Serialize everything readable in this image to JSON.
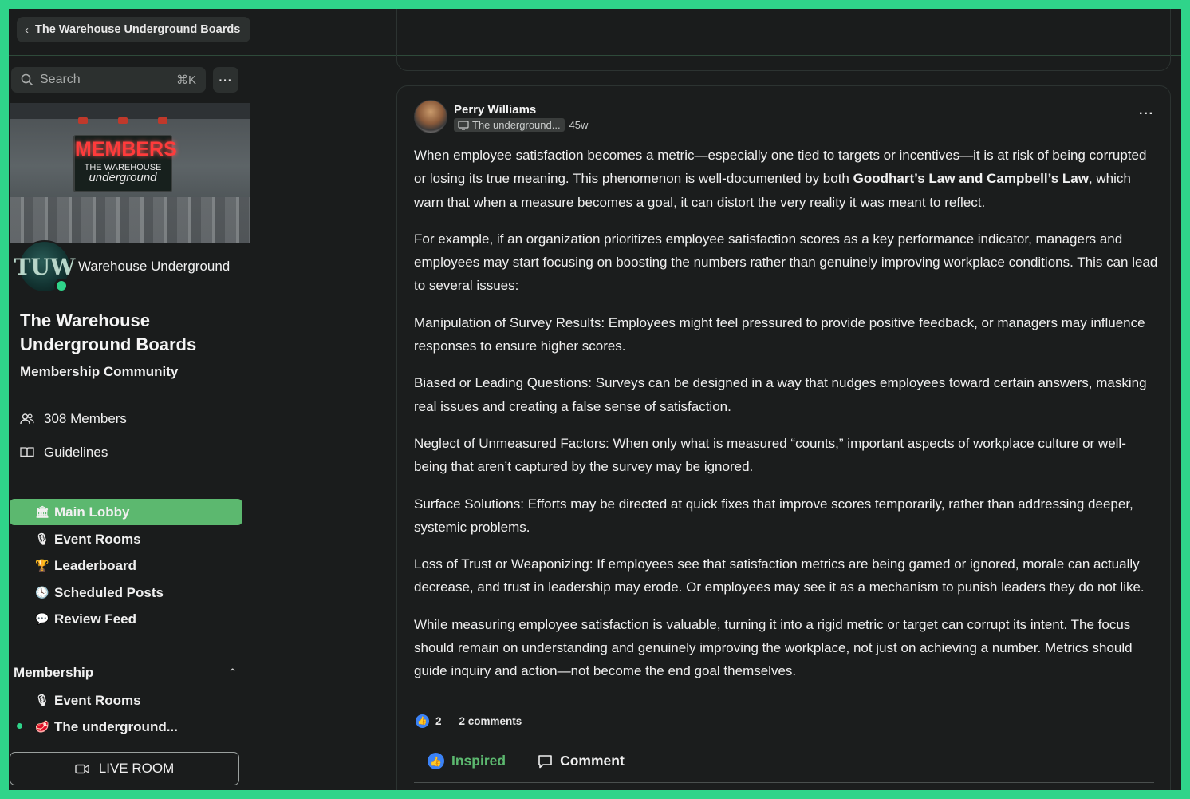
{
  "header": {
    "back_label": "The Warehouse Underground Boards"
  },
  "sidebar": {
    "search_placeholder": "Search",
    "search_shortcut": "⌘K",
    "more_label": "···",
    "banner": {
      "sign_title": "MEMBERS",
      "sign_line1": "THE WAREHOUSE",
      "sign_line2": "underground"
    },
    "avatar_initials": "TUW",
    "community_name": "Warehouse Underground",
    "community_title": "The Warehouse Underground Boards",
    "community_subtitle": "Membership Community",
    "members_label": "308 Members",
    "guidelines_label": "Guidelines",
    "nav": [
      {
        "emoji": "🏛",
        "label": "Main Lobby",
        "active": true
      },
      {
        "emoji": "🎙",
        "label": "Event Rooms"
      },
      {
        "emoji": "🏆",
        "label": "Leaderboard"
      },
      {
        "emoji": "🕓",
        "label": "Scheduled Posts"
      },
      {
        "emoji": "💬",
        "label": "Review Feed"
      }
    ],
    "section": {
      "title": "Membership",
      "items": [
        {
          "emoji": "🎙",
          "label": "Event Rooms"
        },
        {
          "emoji": "🥩",
          "label": "The underground..."
        }
      ]
    },
    "live_room_label": "LIVE ROOM"
  },
  "post": {
    "author": "Perry Williams",
    "channel": "The underground...",
    "age": "45w",
    "more": "···",
    "paragraphs": [
      {
        "pre": "When employee satisfaction becomes a metric—especially one tied to targets or incentives—it is at risk of being corrupted or losing its true meaning. This phenomenon is well-documented by both ",
        "bold": "Goodhart’s Law and Campbell’s Law",
        "post": ", which warn that when a measure becomes a goal, it can distort the very reality it was meant to reflect."
      },
      {
        "text": "For example, if an organization prioritizes employee satisfaction scores as a key performance indicator, managers and employees may start focusing on boosting the numbers rather than genuinely improving workplace conditions. This can lead to several issues:"
      },
      {
        "text": "Manipulation of Survey Results: Employees might feel pressured to provide positive feedback, or managers may influence responses to ensure higher scores."
      },
      {
        "text": "Biased or Leading Questions: Surveys can be designed in a way that nudges employees toward certain answers, masking real issues and creating a false sense of satisfaction."
      },
      {
        "text": "Neglect of Unmeasured Factors: When only what is measured “counts,” important aspects of workplace culture or well-being that aren’t captured by the survey may be ignored."
      },
      {
        "text": "Surface Solutions: Efforts may be directed at quick fixes that improve scores temporarily, rather than addressing deeper, systemic problems."
      },
      {
        "text": "Loss of Trust or Weaponizing: If employees see that satisfaction metrics are being gamed or ignored, morale can actually decrease, and trust in leadership may erode. Or employees may see it as a mechanism to punish leaders they do not like."
      },
      {
        "text": "While measuring employee satisfaction is valuable, turning it into a rigid metric or target can corrupt its intent. The focus should remain on understanding and genuinely improving the workplace, not just on achieving a number. Metrics should guide inquiry and action—not become the end goal themselves."
      }
    ],
    "reaction_count": "2",
    "comments_label": "2 comments",
    "inspired_label": "Inspired",
    "comment_label": "Comment"
  },
  "colors": {
    "accent": "#5cb86f",
    "frame": "#2fd48a",
    "background": "#1a1c1c",
    "like": "#3b82f6"
  }
}
